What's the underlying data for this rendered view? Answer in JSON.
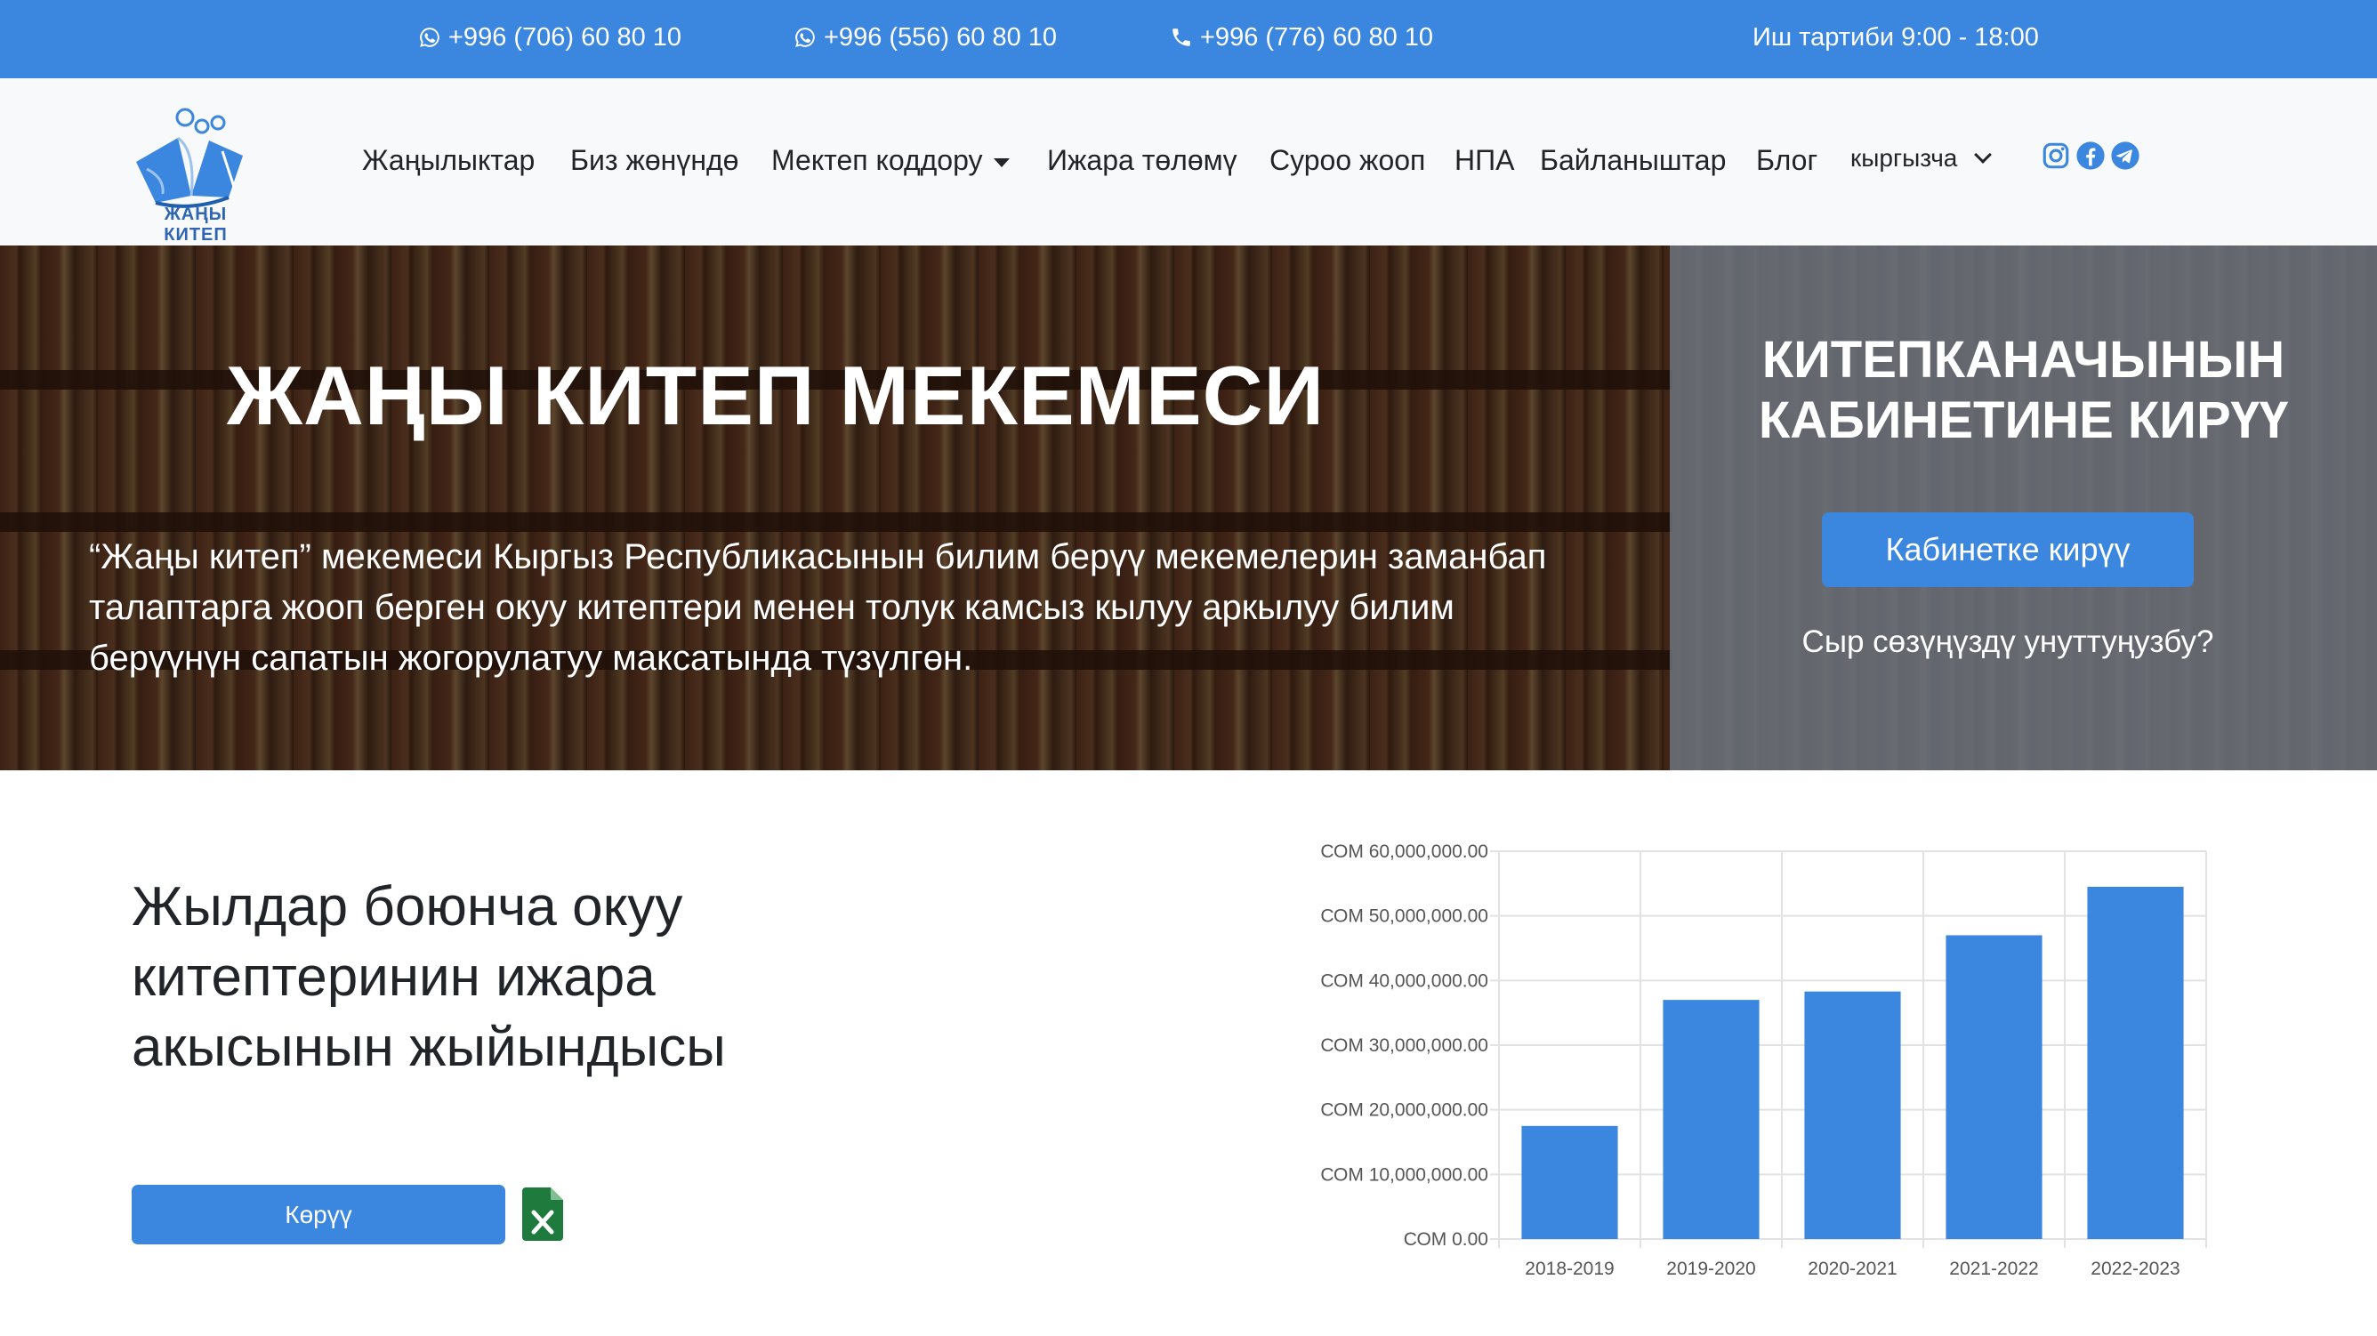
{
  "topbar": {
    "phone1": "+996 (706) 60 80 10",
    "phone2": "+996 (556) 60 80 10",
    "phone3": "+996 (776) 60 80 10",
    "hours": "Иш тартиби 9:00 - 18:00"
  },
  "navbar": {
    "logo_text": "ЖАҢЫ КИТЕП",
    "links": [
      "Жаңылыктар",
      "Биз жөнүндө",
      "Мектеп коддору",
      "Ижара төлөмү",
      "Суроо жооп",
      "НПА",
      "Байланыштар",
      "Блог"
    ],
    "language": "кыргызча",
    "social_icons": [
      "instagram-icon",
      "facebook-icon",
      "telegram-icon"
    ]
  },
  "hero": {
    "title": "ЖАҢЫ КИТЕП МЕКЕМЕСИ",
    "text": "“Жаңы китеп” мекемеси Кыргыз Республикасынын билим берүү мекемелерин заманбап талаптарга жооп берген окуу китептери менен толук камсыз кылуу аркылуу билим берүүнүн сапатын жогорулатуу максатында түзүлгөн."
  },
  "login": {
    "title_line1": "КИТЕПКАНАЧЫНЫН",
    "title_line2": "КАБИНЕТИНЕ КИРҮҮ",
    "button": "Кабинетке кирүү",
    "forgot": "Сыр сөзүңүздү унуттуңузбу?"
  },
  "stats": {
    "title": "Жылдар боюнча окуу китептеринин ижара акысынын жыйындысы",
    "view_button": "Көрүү"
  },
  "colors": {
    "accent": "#3b86de",
    "excel": "#1f7a3e"
  },
  "chart_data": {
    "type": "bar",
    "categories": [
      "2018-2019",
      "2019-2020",
      "2020-2021",
      "2021-2022",
      "2022-2023"
    ],
    "values": [
      17500000,
      37000000,
      38300000,
      47000000,
      54500000
    ],
    "ylim": [
      0,
      60000000
    ],
    "yticks": [
      0,
      10000000,
      20000000,
      30000000,
      40000000,
      50000000,
      60000000
    ],
    "ytick_labels": [
      "СОМ 0.00",
      "СОМ 10,000,000.00",
      "СОМ 20,000,000.00",
      "СОМ 30,000,000.00",
      "СОМ 40,000,000.00",
      "СОМ 50,000,000.00",
      "СОМ 60,000,000.00"
    ],
    "grid": true,
    "color": "#3b86de"
  }
}
